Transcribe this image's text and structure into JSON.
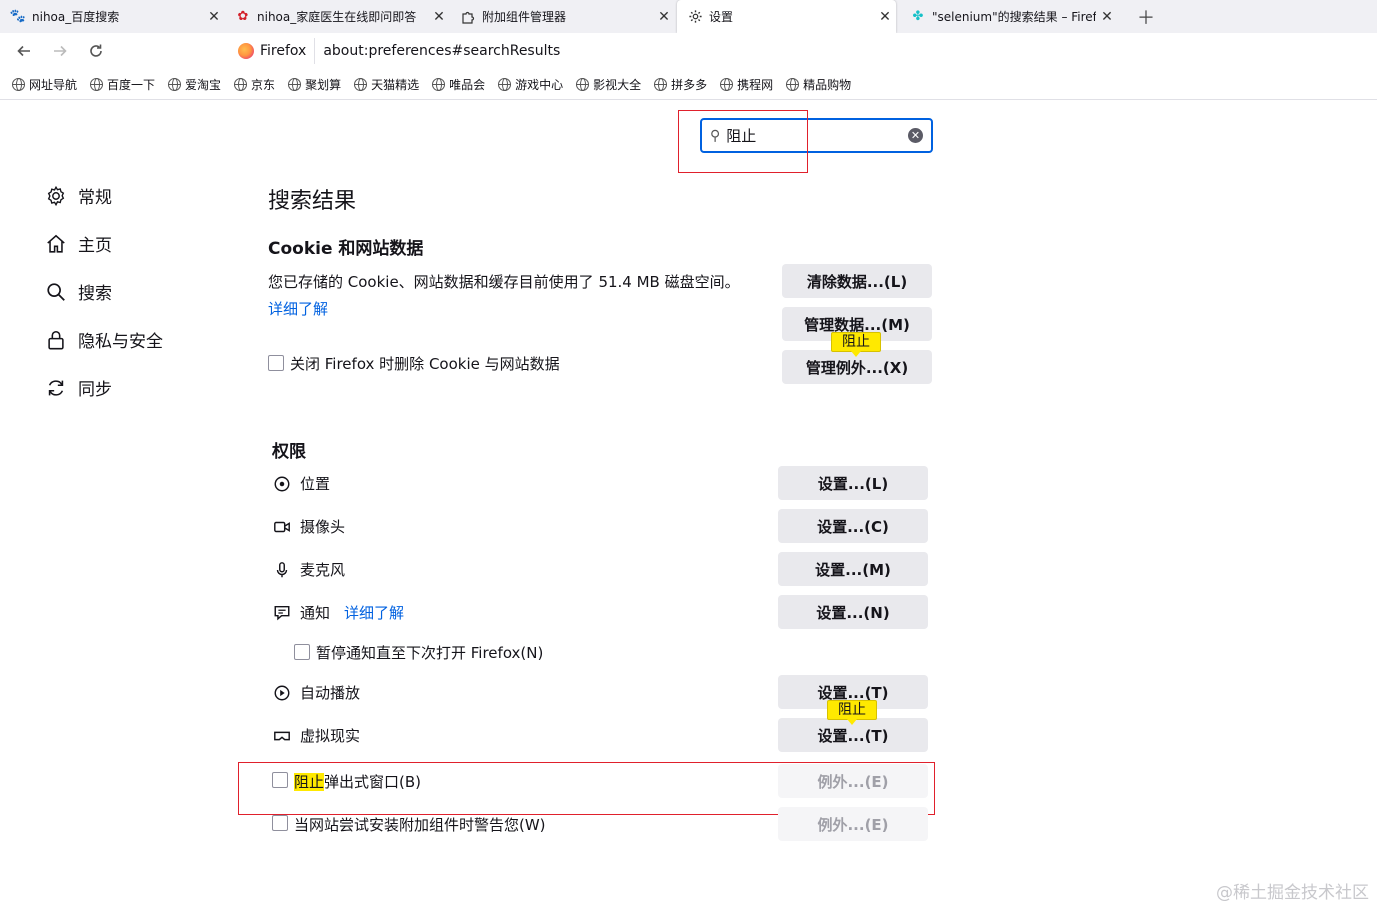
{
  "tabs": [
    {
      "label": "nihoa_百度搜索",
      "icon": "baidu-paw-icon"
    },
    {
      "label": "nihoa_家庭医生在线即问即答",
      "icon": "familydoctor-icon"
    },
    {
      "label": "附加组件管理器",
      "icon": "puzzle-icon"
    },
    {
      "label": "设置",
      "icon": "gear-icon",
      "active": true
    },
    {
      "label": "\"selenium\"的搜索结果 – Firefo",
      "icon": "selenium-icon"
    }
  ],
  "nav": {
    "identity_label": "Firefox",
    "url": "about:preferences#searchResults"
  },
  "bookmarks": [
    "网址导航",
    "百度一下",
    "爱淘宝",
    "京东",
    "聚划算",
    "天猫精选",
    "唯品会",
    "游戏中心",
    "影视大全",
    "拼多多",
    "携程网",
    "精品购物"
  ],
  "search": {
    "value": "阻止"
  },
  "sidebar": {
    "items": [
      {
        "label": "常规",
        "icon": "gear-icon"
      },
      {
        "label": "主页",
        "icon": "home-icon"
      },
      {
        "label": "搜索",
        "icon": "search-icon"
      },
      {
        "label": "隐私与安全",
        "icon": "lock-icon"
      },
      {
        "label": "同步",
        "icon": "sync-icon"
      }
    ]
  },
  "main": {
    "title": "搜索结果",
    "cookie": {
      "heading": "Cookie 和网站数据",
      "desc": "您已存储的 Cookie、网站数据和缓存目前使用了 51.4 MB 磁盘空间。",
      "learn_more": "详细了解",
      "checkbox_label": "关闭 Firefox 时删除 Cookie 与网站数据",
      "clear_btn": "清除数据...(L)",
      "manage_btn": "管理数据...(M)",
      "exceptions_btn": "管理例外...(X)",
      "badge": "阻止"
    },
    "permissions": {
      "heading": "权限",
      "items": [
        {
          "label": "位置",
          "icon": "location-pin-icon",
          "button": "设置...(L)"
        },
        {
          "label": "摄像头",
          "icon": "camera-icon",
          "button": "设置...(C)"
        },
        {
          "label": "麦克风",
          "icon": "microphone-icon",
          "button": "设置...(M)"
        },
        {
          "label": "通知",
          "icon": "notification-icon",
          "button": "设置...(N)",
          "link": "详细了解"
        },
        {
          "label": "自动播放",
          "icon": "autoplay-icon",
          "button": "设置...(T)"
        },
        {
          "label": "虚拟现实",
          "icon": "vr-headset-icon",
          "button": "设置...(T)"
        }
      ],
      "pause_notifications": "暂停通知直至下次打开 Firefox(N)",
      "vr_badge": "阻止",
      "block_popups_highlight": "阻止",
      "block_popups_rest": "弹出式窗口(B)",
      "popups_btn": "例外...(E)",
      "addons_warn_label": "当网站尝试安装附加组件时警告您(W)",
      "addons_btn": "例外...(E)"
    }
  },
  "watermark": "@稀土掘金技术社区"
}
